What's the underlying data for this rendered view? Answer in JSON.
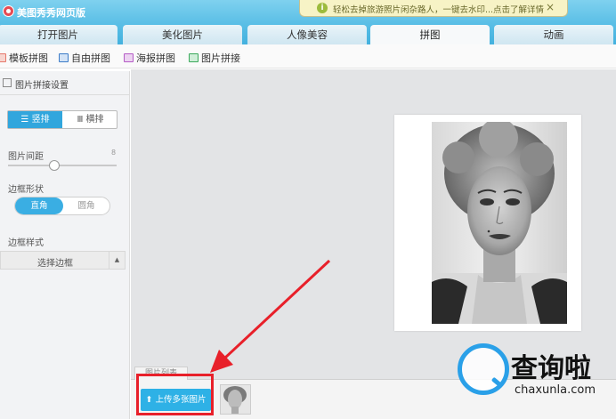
{
  "window": {
    "title": "美图秀秀网页版"
  },
  "notice": {
    "icon": "info-icon",
    "text": "轻松去掉旅游照片闲杂路人，一键去水印...点击了解详情",
    "close": "×"
  },
  "tabs": [
    {
      "label": "打开图片"
    },
    {
      "label": "美化图片"
    },
    {
      "label": "人像美容"
    },
    {
      "label": "拼图",
      "active": true
    },
    {
      "label": "动画"
    }
  ],
  "subtabs": [
    {
      "label": "模板拼图",
      "icon": "template-icon",
      "color": "#e6776a"
    },
    {
      "label": "自由拼图",
      "icon": "free-collage-icon",
      "color": "#3c7bc7"
    },
    {
      "label": "海报拼图",
      "icon": "poster-icon",
      "color": "#b45bc5"
    },
    {
      "label": "图片拼接",
      "icon": "stitch-icon",
      "color": "#3aa85a",
      "active": true
    }
  ],
  "sidebar": {
    "panel_title": "图片拼接设置",
    "orientation": {
      "vertical": "竖排",
      "horizontal": "横排",
      "selected": "竖排"
    },
    "spacing": {
      "label": "图片间距",
      "value": "8"
    },
    "border_shape": {
      "label": "边框形状",
      "square": "直角",
      "round": "圆角",
      "selected": "直角"
    },
    "border_style": {
      "label": "边框样式",
      "select": "选择边框"
    }
  },
  "bottom": {
    "list_tab": "图片列表",
    "upload_button": "上传多张图片"
  },
  "watermark": {
    "brand": "查询啦",
    "domain": "chaxunla.com"
  },
  "colors": {
    "accent": "#2eb1e6",
    "highlight": "#e8202a",
    "titlebar": "#5bbfe6"
  }
}
